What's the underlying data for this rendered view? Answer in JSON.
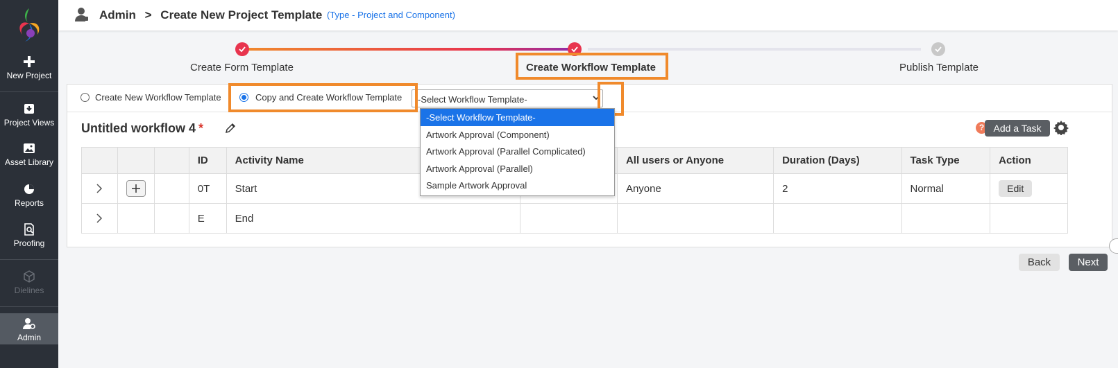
{
  "sidebar": {
    "items": [
      {
        "label": "New Project",
        "icon": "plus-icon"
      },
      {
        "label": "Project Views",
        "icon": "download-box-icon"
      },
      {
        "label": "Asset Library",
        "icon": "image-icon"
      },
      {
        "label": "Reports",
        "icon": "pie-chart-icon"
      },
      {
        "label": "Proofing",
        "icon": "document-search-icon"
      },
      {
        "label": "Dielines",
        "icon": "cube-icon",
        "disabled": true
      },
      {
        "label": "Admin",
        "icon": "user-gear-icon",
        "active": true
      }
    ]
  },
  "header": {
    "crumb_root": "Admin",
    "crumb_sep": ">",
    "crumb_current": "Create New Project Template",
    "type_note": "(Type - Project and Component)"
  },
  "stepper": {
    "steps": [
      {
        "label": "Create Form Template",
        "state": "done"
      },
      {
        "label": "Create Workflow Template",
        "state": "active"
      },
      {
        "label": "Publish Template",
        "state": "pending"
      }
    ]
  },
  "workflow_source": {
    "option_new": "Create New Workflow Template",
    "option_copy": "Copy and Create Workflow Template",
    "selected": "copy",
    "select_value": "-Select Workflow Template-",
    "options": [
      "-Select Workflow Template-",
      "Artwork Approval (Component)",
      "Artwork Approval (Parallel Complicated)",
      "Artwork Approval (Parallel)",
      "Sample Artwork Approval"
    ]
  },
  "workflow": {
    "name": "Untitled workflow 4",
    "required_mark": "*",
    "help_label": "?",
    "add_task_label": "Add a Task"
  },
  "table": {
    "headers": [
      "",
      "",
      "",
      "ID",
      "Activity Name",
      "",
      "All users or Anyone",
      "Duration (Days)",
      "Task Type",
      "Action"
    ],
    "rows": [
      {
        "id": "0T",
        "activity": "Start",
        "users": "Anyone",
        "duration": "2",
        "task_type": "Normal",
        "action": "Edit"
      },
      {
        "id": "E",
        "activity": "End",
        "users": "",
        "duration": "",
        "task_type": "",
        "action": ""
      }
    ]
  },
  "footer": {
    "back_label": "Back",
    "next_label": "Next"
  },
  "colors": {
    "sidebar_bg": "#2b3038",
    "accent_blue": "#1a73e8",
    "highlight_orange": "#f08a2c",
    "step_done": "#e8344e",
    "dark_button": "#5a5e63"
  }
}
